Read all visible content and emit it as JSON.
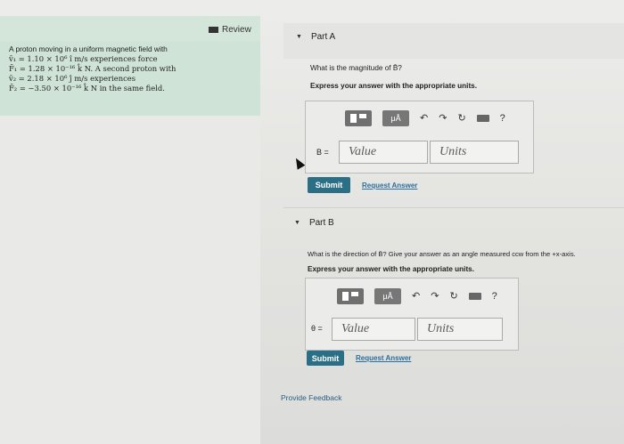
{
  "review": {
    "label": "Review"
  },
  "problem": {
    "line1": "A proton moving in a uniform magnetic field with",
    "line2": "v̄₁ = 1.10 × 10⁶ î m/s experiences force",
    "line3": "F̄₁ = 1.28 × 10⁻¹⁶ k̂ N. A second proton with",
    "line4": "v̄₂ = 2.18 × 10⁶ ĵ m/s experiences",
    "line5": "F̄₂ = −3.50 × 10⁻¹⁶ k̂ N in the same field."
  },
  "partA": {
    "title": "Part A",
    "question": "What is the magnitude of B̄?",
    "instruction": "Express your answer with the appropriate units.",
    "variable_label": "B =",
    "value_placeholder": "Value",
    "units_placeholder": "Units",
    "submit_label": "Submit",
    "request_label": "Request Answer",
    "mu_label": "μÅ",
    "help_label": "?"
  },
  "partB": {
    "title": "Part B",
    "question": "What is the direction of B̄? Give your answer as an angle measured ccw from the +x-axis.",
    "instruction": "Express your answer with the appropriate units.",
    "variable_label": "θ =",
    "value_placeholder": "Value",
    "units_placeholder": "Units",
    "submit_label": "Submit",
    "request_label": "Request Answer",
    "mu_label": "μÅ",
    "help_label": "?"
  },
  "feedback": {
    "label": "Provide Feedback"
  },
  "icons": {
    "undo": "↶",
    "redo": "↷",
    "reset": "↻"
  }
}
